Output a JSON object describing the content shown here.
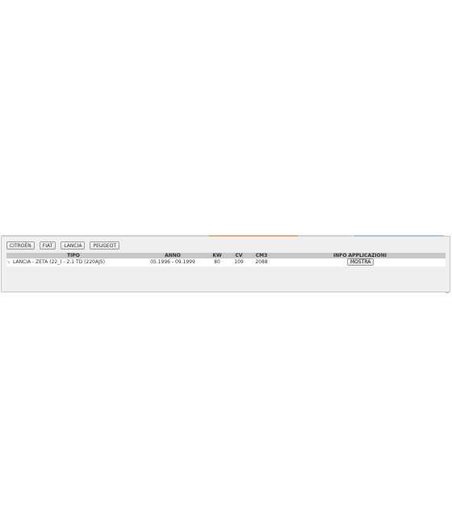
{
  "brands": [
    "CITROËN",
    "FIAT",
    "LANCIA",
    "PEUGEOT"
  ],
  "table": {
    "columns": {
      "tipo": "TIPO",
      "anno": "ANNO",
      "kw": "KW",
      "cv": "CV",
      "cm3": "CM3",
      "info": "INFO APPLICAZIONI"
    },
    "rows": [
      {
        "tipo": "LANCIA - ZETA (22_) - 2.1 TD (220AJ5)",
        "anno": "05.1996 - 09.1999",
        "kw": "80",
        "cv": "109",
        "cm3": "2088",
        "action_label": "MOSTRA"
      }
    ]
  },
  "colors": {
    "tab_accent_orange": "#e2b27a",
    "tab_accent_blue": "#a9c8e2",
    "header_bg": "#c7c7c7",
    "panel_bg": "#efefef"
  },
  "icons": {
    "row_icon": "arrow-right-icon"
  }
}
